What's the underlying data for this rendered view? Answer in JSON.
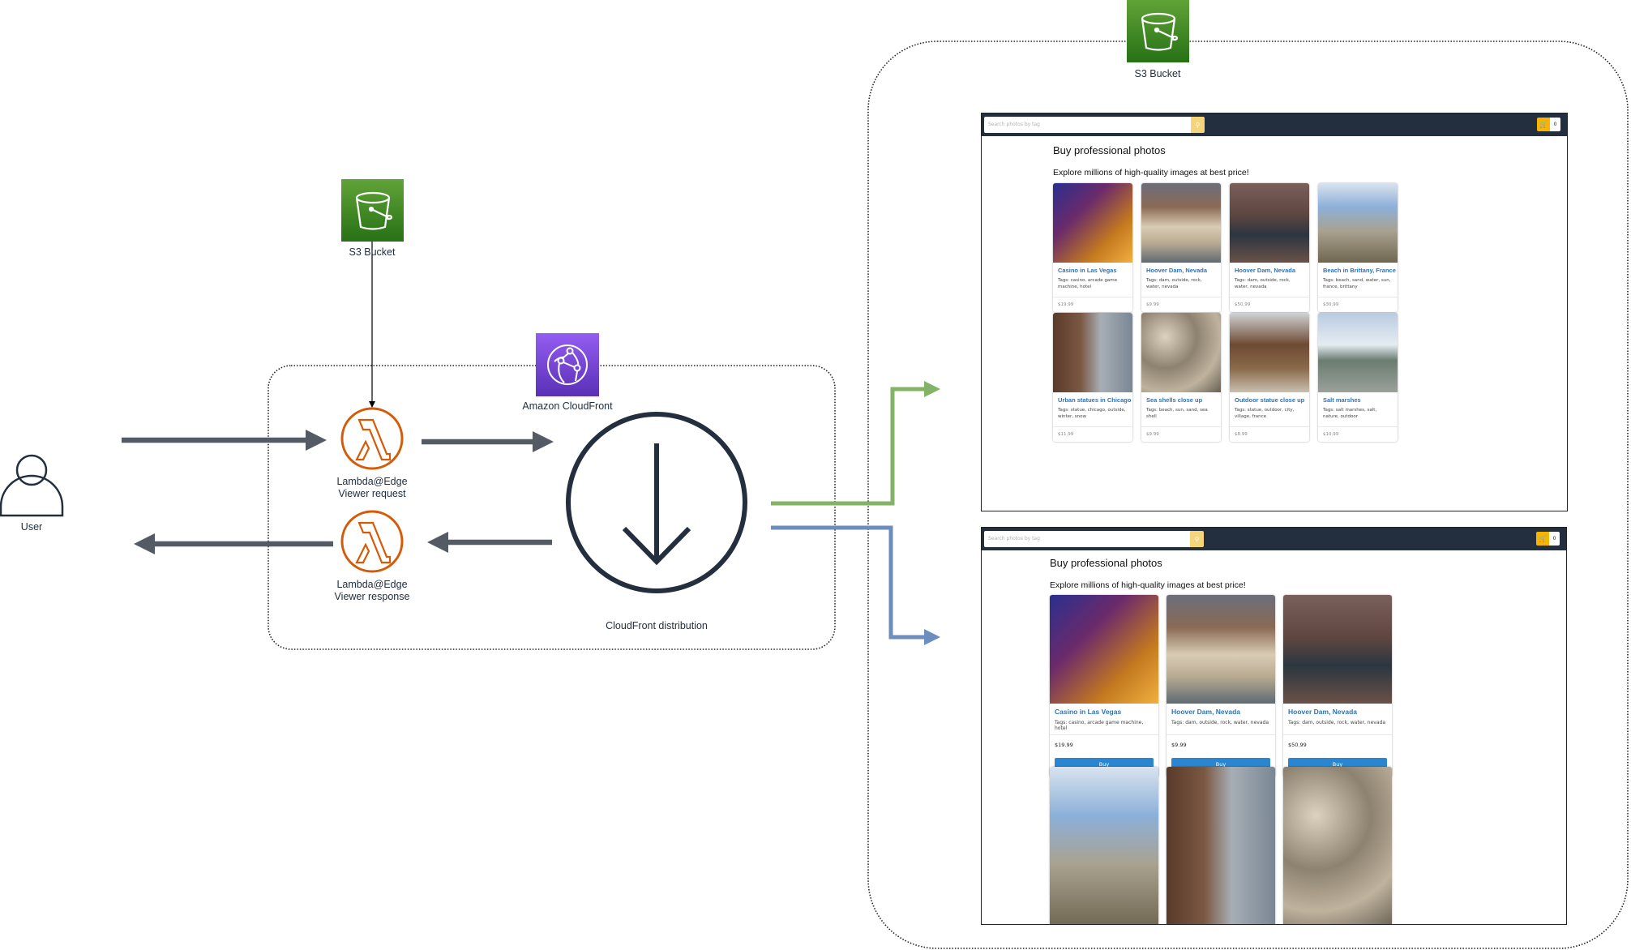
{
  "diagram": {
    "nodes": {
      "user": {
        "label": "User",
        "icon": "user-icon"
      },
      "s3_origin": {
        "label": "S3 Bucket",
        "icon": "s3-bucket-icon",
        "color": "#3f8624"
      },
      "cloudfront": {
        "label": "Amazon CloudFront",
        "icon": "cloudfront-icon",
        "color": "#7a45d6"
      },
      "lambda_request": {
        "label_line1": "Lambda@Edge",
        "label_line2": "Viewer request",
        "icon": "lambda-icon",
        "color": "#d45b07"
      },
      "lambda_response": {
        "label_line1": "Lambda@Edge",
        "label_line2": "Viewer response",
        "icon": "lambda-icon",
        "color": "#d45b07"
      },
      "distribution": {
        "label": "CloudFront distribution",
        "icon": "download-arrow-icon"
      },
      "s3_site": {
        "label": "S3 Bucket",
        "icon": "s3-bucket-icon"
      }
    },
    "edge_colors": {
      "main": "#545b64",
      "variant_a": "#82b366",
      "variant_b": "#6c8ebf",
      "origin": "#000000"
    }
  },
  "site_a": {
    "search_placeholder": "Search photos by tag",
    "search_icon": "search-icon",
    "cart_icon": "cart-icon",
    "cart_count": "0",
    "heading": "Buy professional photos",
    "subheading": "Explore millions of high-quality images at best price!",
    "products": [
      {
        "title": "Casino in Las Vegas",
        "tags": "Tags: casino, arcade game machine, hotel",
        "price": "$19.99"
      },
      {
        "title": "Hoover Dam, Nevada",
        "tags": "Tags: dam, outside, rock, water, nevada",
        "price": "$9.99"
      },
      {
        "title": "Hoover Dam, Nevada",
        "tags": "Tags: dam, outside, rock, water, nevada",
        "price": "$50.99"
      },
      {
        "title": "Beach in Brittany, France",
        "tags": "Tags: beach, sand, water, sun, france, brittany",
        "price": "$30.99"
      },
      {
        "title": "Urban statues in Chicago",
        "tags": "Tags: statue, chicago, outside, winter, snow",
        "price": "$11.99"
      },
      {
        "title": "Sea shells close up",
        "tags": "Tags: beach, sun, sand, sea shell",
        "price": "$9.99"
      },
      {
        "title": "Outdoor statue close up",
        "tags": "Tags: statue, outdoor, city, village, france",
        "price": "$8.99"
      },
      {
        "title": "Salt marshes",
        "tags": "Tags: salt marshes, salt, nature, outdoor",
        "price": "$10.99"
      }
    ]
  },
  "site_b": {
    "search_placeholder": "Search photos by tag",
    "search_icon": "search-icon",
    "cart_icon": "cart-icon",
    "cart_count": "0",
    "heading": "Buy professional photos",
    "subheading": "Explore millions of high-quality images at best price!",
    "buy_label": "Buy",
    "products": [
      {
        "title": "Casino in Las Vegas",
        "tags": "Tags: casino, arcade game machine, hotel",
        "price": "$19.99"
      },
      {
        "title": "Hoover Dam, Nevada",
        "tags": "Tags: dam, outside, rock, water, nevada",
        "price": "$9.99"
      },
      {
        "title": "Hoover Dam, Nevada",
        "tags": "Tags: dam, outside, rock, water, nevada",
        "price": "$50.99"
      }
    ],
    "more_photos": [
      "beach photo",
      "urban statues photo",
      "sea shells photo"
    ]
  }
}
